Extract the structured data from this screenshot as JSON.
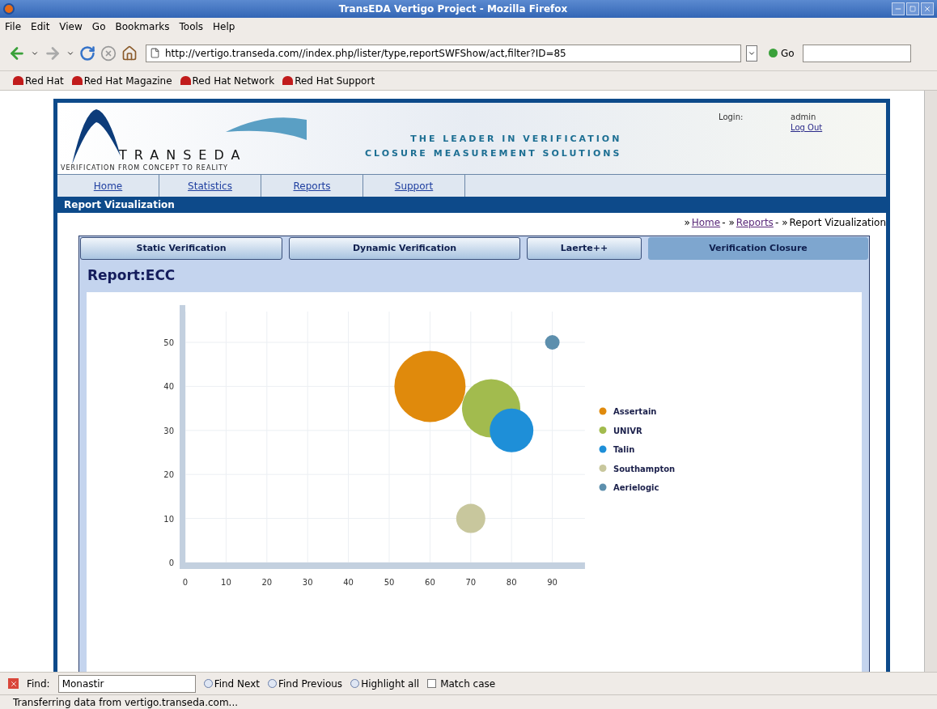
{
  "window": {
    "title": "TransEDA Vertigo Project - Mozilla Firefox"
  },
  "menu": [
    "File",
    "Edit",
    "View",
    "Go",
    "Bookmarks",
    "Tools",
    "Help"
  ],
  "address": {
    "value": "http://vertigo.transeda.com//index.php/lister/type,reportSWFShow/act,filter?ID=85",
    "go": "Go"
  },
  "bookmarks": [
    "Red Hat",
    "Red Hat Magazine",
    "Red Hat Network",
    "Red Hat Support"
  ],
  "banner": {
    "logo": "TRANSEDA",
    "tagline": "VERIFICATION FROM CONCEPT TO REALITY",
    "slogan": [
      "THE LEADER IN VERIFICATION",
      "CLOSURE MEASUREMENT SOLUTIONS"
    ],
    "login_label": "Login:",
    "user": "admin",
    "logout": "Log Out"
  },
  "nav": [
    "Home",
    "Statistics",
    "Reports",
    "Support"
  ],
  "section_title": "Report Vizualization",
  "breadcrumbs": [
    {
      "kind": "link",
      "prefix": "»",
      "text": "Home",
      "suffix": "-"
    },
    {
      "kind": "link",
      "prefix": "»",
      "text": "Reports",
      "suffix": "-"
    },
    {
      "kind": "current",
      "prefix": "»",
      "text": "Report Vizualization"
    }
  ],
  "tabs": [
    {
      "label": "Static Verification",
      "selected": false
    },
    {
      "label": "Dynamic Verification",
      "selected": false
    },
    {
      "label": "Laerte++",
      "selected": false
    },
    {
      "label": "Verification Closure",
      "selected": true
    }
  ],
  "report_title": "Report:ECC",
  "chart_data": {
    "type": "scatter",
    "grid": true,
    "legend": "right",
    "xlim": [
      0,
      98
    ],
    "ylim": [
      0,
      57
    ],
    "xticks": [
      0,
      10,
      20,
      30,
      40,
      50,
      60,
      70,
      80,
      90
    ],
    "yticks": [
      0,
      10,
      20,
      30,
      40,
      50
    ],
    "series": [
      {
        "name": "Assertain",
        "color": "#e08a0c",
        "x": [
          60
        ],
        "values": [
          40
        ]
      },
      {
        "name": "UNIVR",
        "color": "#a2bb4e",
        "x": [
          75
        ],
        "values": [
          35
        ]
      },
      {
        "name": "Talin",
        "color": "#1e8fd8",
        "x": [
          80
        ],
        "values": [
          30
        ]
      },
      {
        "name": "Southampton",
        "color": "#c8c79d",
        "x": [
          70
        ],
        "values": [
          10
        ]
      },
      {
        "name": "Aerielogic",
        "color": "#5d8fad",
        "x": [
          90
        ],
        "values": [
          50
        ]
      }
    ]
  },
  "findbar": {
    "label": "Find:",
    "value": "Monastir",
    "buttons": [
      "Find Next",
      "Find Previous",
      "Highlight all"
    ],
    "match_case": {
      "label": "Match case",
      "checked": false
    }
  },
  "status": "Transferring data from vertigo.transeda.com..."
}
